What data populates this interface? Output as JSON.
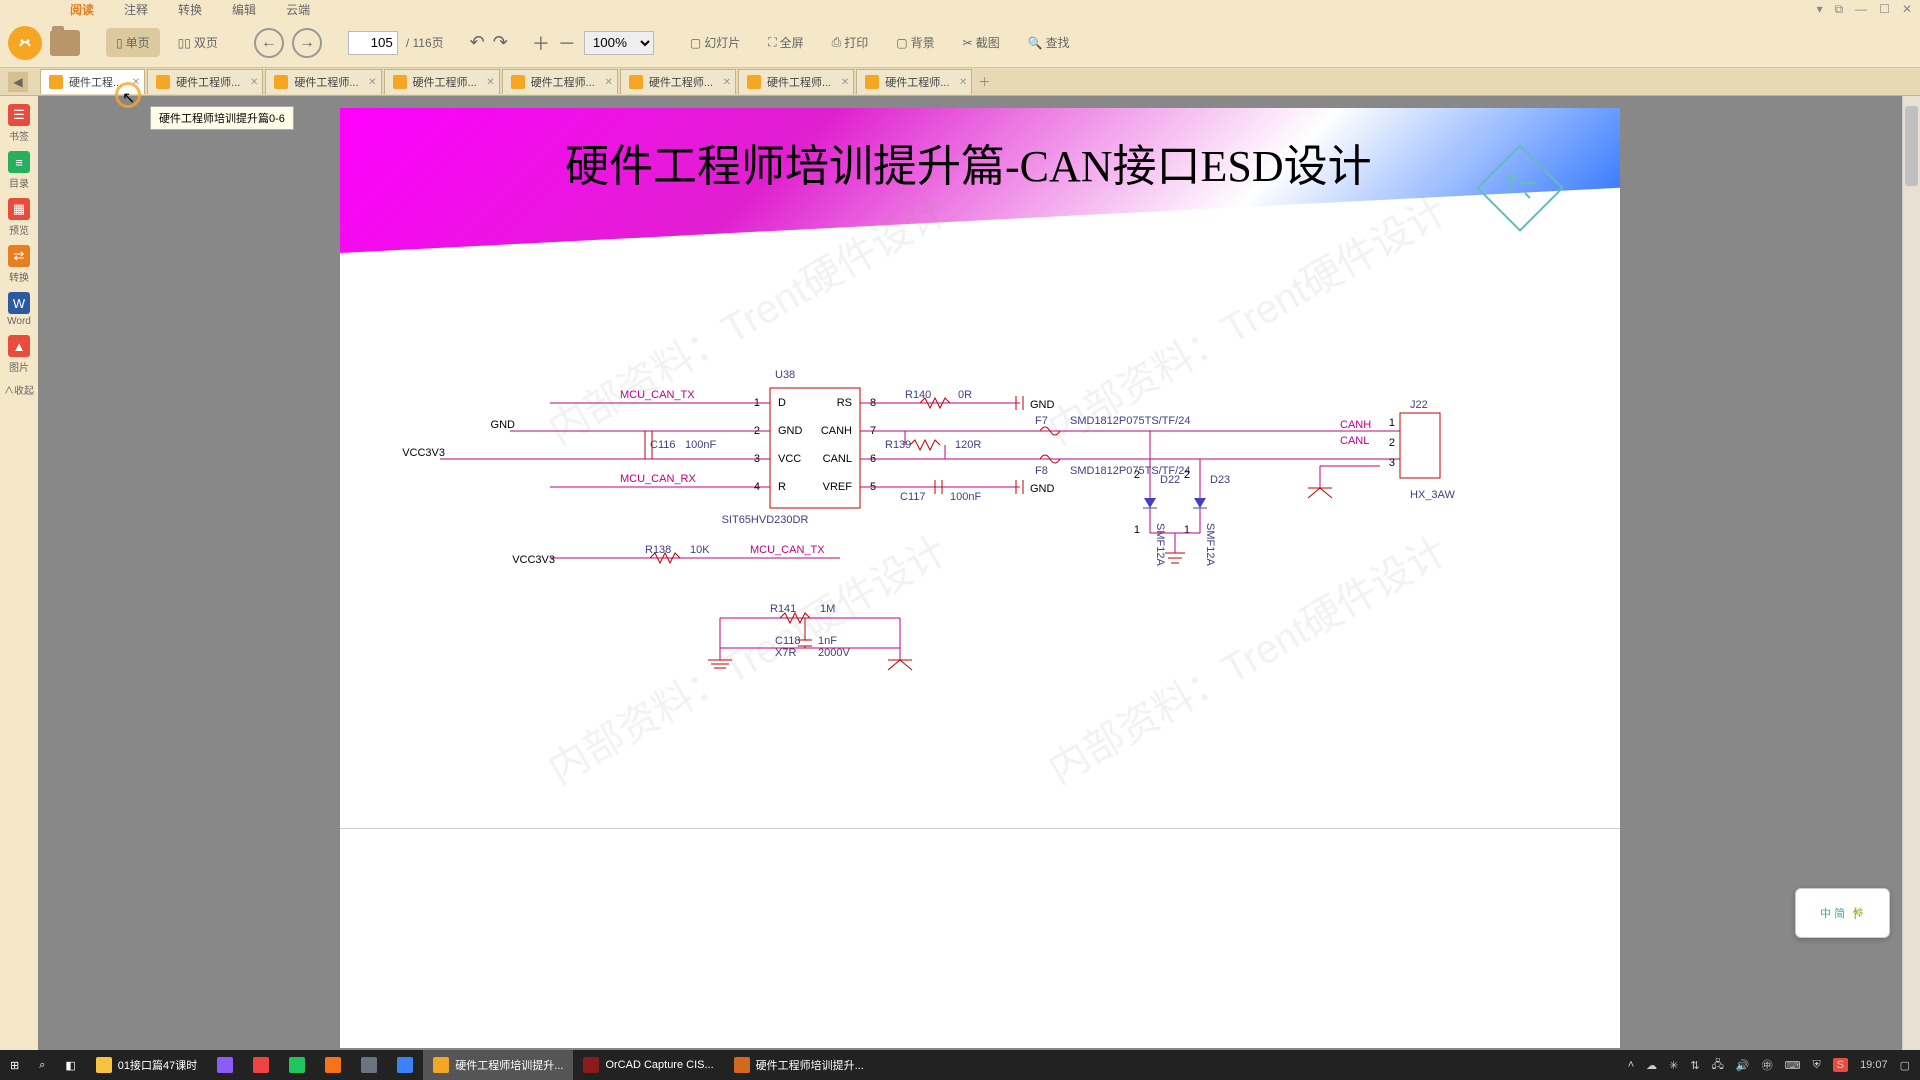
{
  "titlebar": {
    "tabs": [
      "阅读",
      "注释",
      "转换",
      "编辑",
      "云端"
    ],
    "active": 0
  },
  "toolbar": {
    "singlePage": "单页",
    "doublePage": "双页",
    "pageCurrent": "105",
    "pageTotal": "/ 116页",
    "zoom": "100%",
    "slideshow": "幻灯片",
    "fullscreen": "全屏",
    "print": "打印",
    "background": "背景",
    "screenshot": "截图",
    "search": "查找"
  },
  "docTabs": {
    "active": 0,
    "labels": [
      "硬件工程...",
      "硬件工程师...",
      "硬件工程师...",
      "硬件工程师...",
      "硬件工程师...",
      "硬件工程师...",
      "硬件工程师...",
      "硬件工程师..."
    ]
  },
  "tooltip": "硬件工程师培训提升篇0-6",
  "sidebar": [
    {
      "color": "#e74c3c",
      "icon": "☰",
      "label": "书签"
    },
    {
      "color": "#27ae60",
      "icon": "≡",
      "label": "目录"
    },
    {
      "color": "#e74c3c",
      "icon": "▦",
      "label": "预览"
    },
    {
      "color": "#e67e22",
      "icon": "⇄",
      "label": "转换"
    },
    {
      "color": "#2c3e50",
      "icon": "W",
      "label": "Word"
    },
    {
      "color": "#e74c3c",
      "icon": "▲",
      "label": "图片"
    },
    {
      "color": "",
      "icon": "∧",
      "label": "∧收起"
    }
  ],
  "slide": {
    "title": "硬件工程师培训提升篇-CAN接口ESD设计",
    "chip": {
      "ref": "U38",
      "part": "SIT65HVD230DR",
      "lpins": [
        [
          "1",
          "D"
        ],
        [
          "2",
          "GND"
        ],
        [
          "3",
          "VCC"
        ],
        [
          "4",
          "R"
        ]
      ],
      "rpins": [
        [
          "8",
          "RS"
        ],
        [
          "7",
          "CANH"
        ],
        [
          "6",
          "CANL"
        ],
        [
          "5",
          "VREF"
        ]
      ]
    },
    "nets": {
      "tx": "MCU_CAN_TX",
      "rx": "MCU_CAN_RX",
      "gnd": "GND",
      "vcc": "VCC3V3",
      "canh": "CANH",
      "canl": "CANL",
      "conn": "J22",
      "conntype": "HX_3AW"
    },
    "comps": {
      "C116": {
        "ref": "C116",
        "val": "100nF"
      },
      "C117": {
        "ref": "C117",
        "val": "100nF"
      },
      "C118": {
        "ref": "C118",
        "val": "1nF",
        "extra": "X7R",
        "extra2": "2000V"
      },
      "R138": {
        "ref": "R138",
        "val": "10K"
      },
      "R139": {
        "ref": "R139",
        "val": "120R"
      },
      "R140": {
        "ref": "R140",
        "val": "0R"
      },
      "R141": {
        "ref": "R141",
        "val": "1M"
      },
      "F7": {
        "ref": "F7",
        "val": "SMD1812P075TS/TF/24"
      },
      "F8": {
        "ref": "F8",
        "val": "SMD1812P075TS/TF/24"
      },
      "D22": {
        "ref": "D22",
        "val": "SMF12A"
      },
      "D23": {
        "ref": "D23",
        "val": "SMF12A"
      }
    },
    "watermark": "内部资料：Trent硬件设计"
  },
  "taskbar": {
    "items": [
      {
        "label": "01接口篇47课时",
        "color": "#f5c542",
        "active": false
      },
      {
        "label": "",
        "color": "#8b5cf6",
        "active": false
      },
      {
        "label": "",
        "color": "#ef4444",
        "active": false
      },
      {
        "label": "",
        "color": "#22c55e",
        "active": false
      },
      {
        "label": "",
        "color": "#f97316",
        "active": false
      },
      {
        "label": "",
        "color": "#6b7280",
        "active": false
      },
      {
        "label": "",
        "color": "#3b82f6",
        "active": false
      },
      {
        "label": "硬件工程师培训提升...",
        "color": "#f5a623",
        "active": true
      },
      {
        "label": "OrCAD Capture CIS...",
        "color": "#8b1a1a",
        "active": false
      },
      {
        "label": "硬件工程师培训提升...",
        "color": "#d2691e",
        "active": false
      }
    ],
    "time": "19:07"
  },
  "ime": {
    "label": "中 简"
  }
}
